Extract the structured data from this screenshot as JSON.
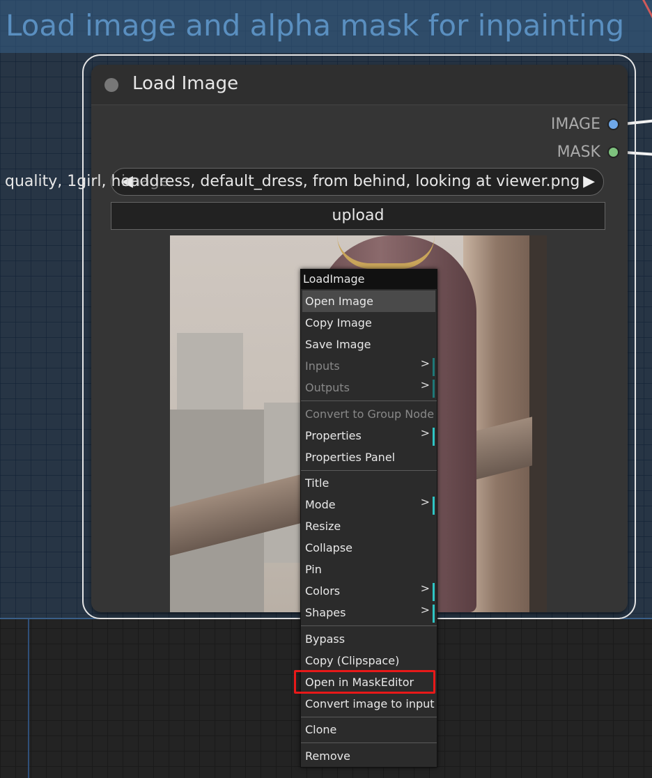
{
  "group": {
    "title": "Load image and alpha mask for inpainting"
  },
  "node": {
    "title": "Load Image",
    "outputs": [
      {
        "label": "IMAGE",
        "color": "#6fa8e8"
      },
      {
        "label": "MASK",
        "color": "#7ec27e"
      }
    ],
    "image_widget": {
      "left_arrow": "◀",
      "right_arrow": "▶",
      "value": "quality, 1girl,  headdress, default_dress, from behind, looking at viewer.png",
      "overlay_label": "image"
    },
    "upload_label": "upload"
  },
  "context_menu": {
    "title": "LoadImage",
    "groups": [
      [
        {
          "label": "Open Image",
          "hover": true
        },
        {
          "label": "Copy Image"
        },
        {
          "label": "Save Image"
        },
        {
          "label": "Inputs",
          "disabled": true,
          "submenu": true
        },
        {
          "label": "Outputs",
          "disabled": true,
          "submenu": true
        }
      ],
      [
        {
          "label": "Convert to Group Node",
          "disabled": true
        },
        {
          "label": "Properties",
          "submenu": true
        },
        {
          "label": "Properties Panel"
        }
      ],
      [
        {
          "label": "Title"
        },
        {
          "label": "Mode",
          "submenu": true
        },
        {
          "label": "Resize"
        },
        {
          "label": "Collapse"
        },
        {
          "label": "Pin"
        },
        {
          "label": "Colors",
          "submenu": true
        },
        {
          "label": "Shapes",
          "submenu": true
        }
      ],
      [
        {
          "label": "Bypass"
        },
        {
          "label": "Copy (Clipspace)"
        },
        {
          "label": "Open in MaskEditor",
          "highlighted": true
        },
        {
          "label": "Convert image to input"
        }
      ],
      [
        {
          "label": "Clone"
        }
      ],
      [
        {
          "label": "Remove"
        }
      ]
    ],
    "submenu_arrow": ">"
  },
  "colors": {
    "highlight": "#e81919",
    "submenu_bar": "#2fc4c4"
  }
}
